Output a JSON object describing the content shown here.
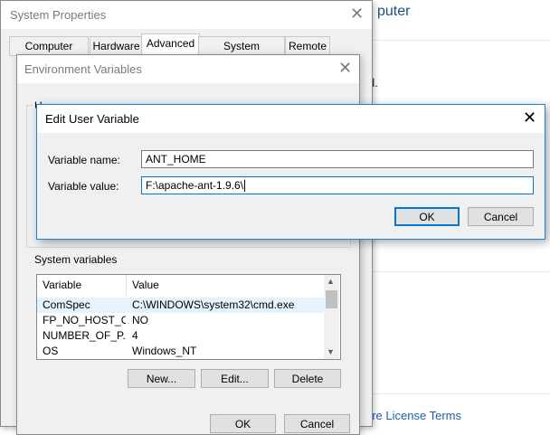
{
  "background": {
    "title_fragment": "puter",
    "text_fragment": "d.",
    "link_fragment": "are License Terms"
  },
  "system_properties": {
    "title": "System Properties",
    "close_glyph": "✕",
    "tabs": [
      {
        "label": "Computer Name"
      },
      {
        "label": "Hardware"
      },
      {
        "label": "Advanced",
        "active": true
      },
      {
        "label": "System Protection"
      },
      {
        "label": "Remote"
      }
    ],
    "ok_label": "OK",
    "cancel_label": "Cancel"
  },
  "environment_variables": {
    "title": "Environment Variables",
    "close_glyph": "✕",
    "user_group_label": "U",
    "system_group_label": "System variables",
    "columns": [
      "Variable",
      "Value"
    ],
    "rows": [
      {
        "variable": "ComSpec",
        "value": "C:\\WINDOWS\\system32\\cmd.exe",
        "selected": true
      },
      {
        "variable": "FP_NO_HOST_C...",
        "value": "NO"
      },
      {
        "variable": "NUMBER_OF_P...",
        "value": "4"
      },
      {
        "variable": "OS",
        "value": "Windows_NT"
      }
    ],
    "new_label": "New...",
    "edit_label": "Edit...",
    "delete_label": "Delete"
  },
  "edit_user_variable": {
    "title": "Edit User Variable",
    "close_glyph": "✕",
    "name_label": "Variable name:",
    "name_value": "ANT_HOME",
    "value_label": "Variable value:",
    "value_value": "F:\\apache-ant-1.9.6\\",
    "ok_label": "OK",
    "cancel_label": "Cancel"
  }
}
